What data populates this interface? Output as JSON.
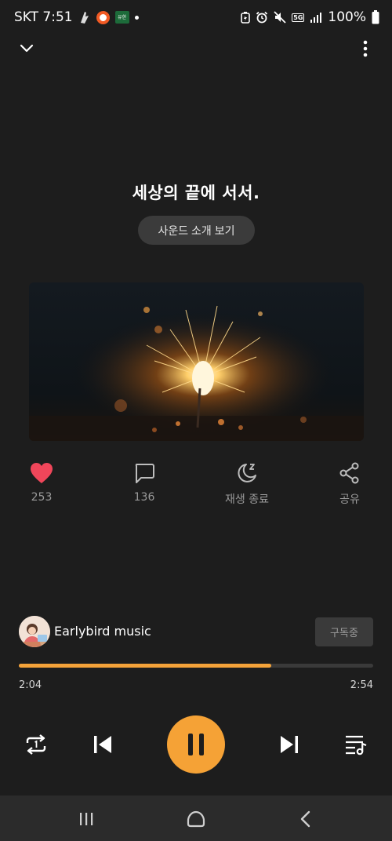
{
  "status_bar": {
    "time_text": "SKT 7:51",
    "battery": "100%",
    "network": "5G",
    "app_badge": "유한에 독서실"
  },
  "track": {
    "title": "세상의 끝에 서서.",
    "intro_button": "사운드 소개 보기"
  },
  "actions": [
    {
      "icon": "heart-icon",
      "label": "253"
    },
    {
      "icon": "comment-icon",
      "label": "136"
    },
    {
      "icon": "sleep-timer-icon",
      "label": "재생 종료"
    },
    {
      "icon": "share-icon",
      "label": "공유"
    }
  ],
  "artist": {
    "name": "Earlybird music",
    "subscribe_label": "구독중"
  },
  "progress": {
    "current": "2:04",
    "total": "2:54",
    "fraction": 0.713
  },
  "controls": [
    "repeat-icon",
    "previous-icon",
    "pause-icon",
    "next-icon",
    "playlist-icon"
  ],
  "colors": {
    "accent": "#f5a236",
    "heart": "#f0465a",
    "background": "#1d1d1d"
  }
}
